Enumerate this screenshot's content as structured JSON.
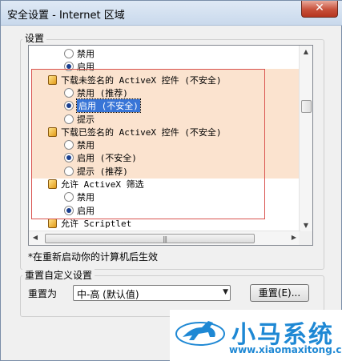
{
  "window": {
    "title": "安全设置 - Internet 区域",
    "close_glyph": "✕"
  },
  "settings_group": {
    "label": "设置",
    "rows": [
      {
        "type": "option",
        "label": "禁用",
        "selected": false
      },
      {
        "type": "option",
        "label": "启用",
        "selected": true
      },
      {
        "type": "item",
        "label": "下载未签名的 ActiveX 控件 (不安全)"
      },
      {
        "type": "option",
        "label": "禁用 (推荐)",
        "selected": false
      },
      {
        "type": "option",
        "label": "启用 (不安全)",
        "selected": true,
        "focused": true
      },
      {
        "type": "option",
        "label": "提示",
        "selected": false
      },
      {
        "type": "item",
        "label": "下载已签名的 ActiveX 控件 (不安全)"
      },
      {
        "type": "option",
        "label": "禁用",
        "selected": false
      },
      {
        "type": "option",
        "label": "启用 (不安全)",
        "selected": true
      },
      {
        "type": "option",
        "label": "提示 (推荐)",
        "selected": false
      },
      {
        "type": "item",
        "label": "允许 ActiveX 筛选"
      },
      {
        "type": "option",
        "label": "禁用",
        "selected": false
      },
      {
        "type": "option",
        "label": "启用",
        "selected": true
      },
      {
        "type": "item",
        "label": "允许 Scriptlet"
      },
      {
        "type": "option",
        "label": "禁用",
        "selected": false
      }
    ]
  },
  "restart_note": "*在重新启动你的计算机后生效",
  "reset_group": {
    "label": "重置自定义设置",
    "reset_to_label": "重置为",
    "combo_value": "中-高 (默认值)",
    "reset_button": "重置(E)..."
  },
  "watermark": {
    "brand": "小马系统",
    "url": "www.xiaomaxitong.com",
    "color": "#1e88d4"
  },
  "colors": {
    "highlight": "#fbe3cf",
    "red_box": "#d9534f",
    "selection": "#3875d7"
  }
}
